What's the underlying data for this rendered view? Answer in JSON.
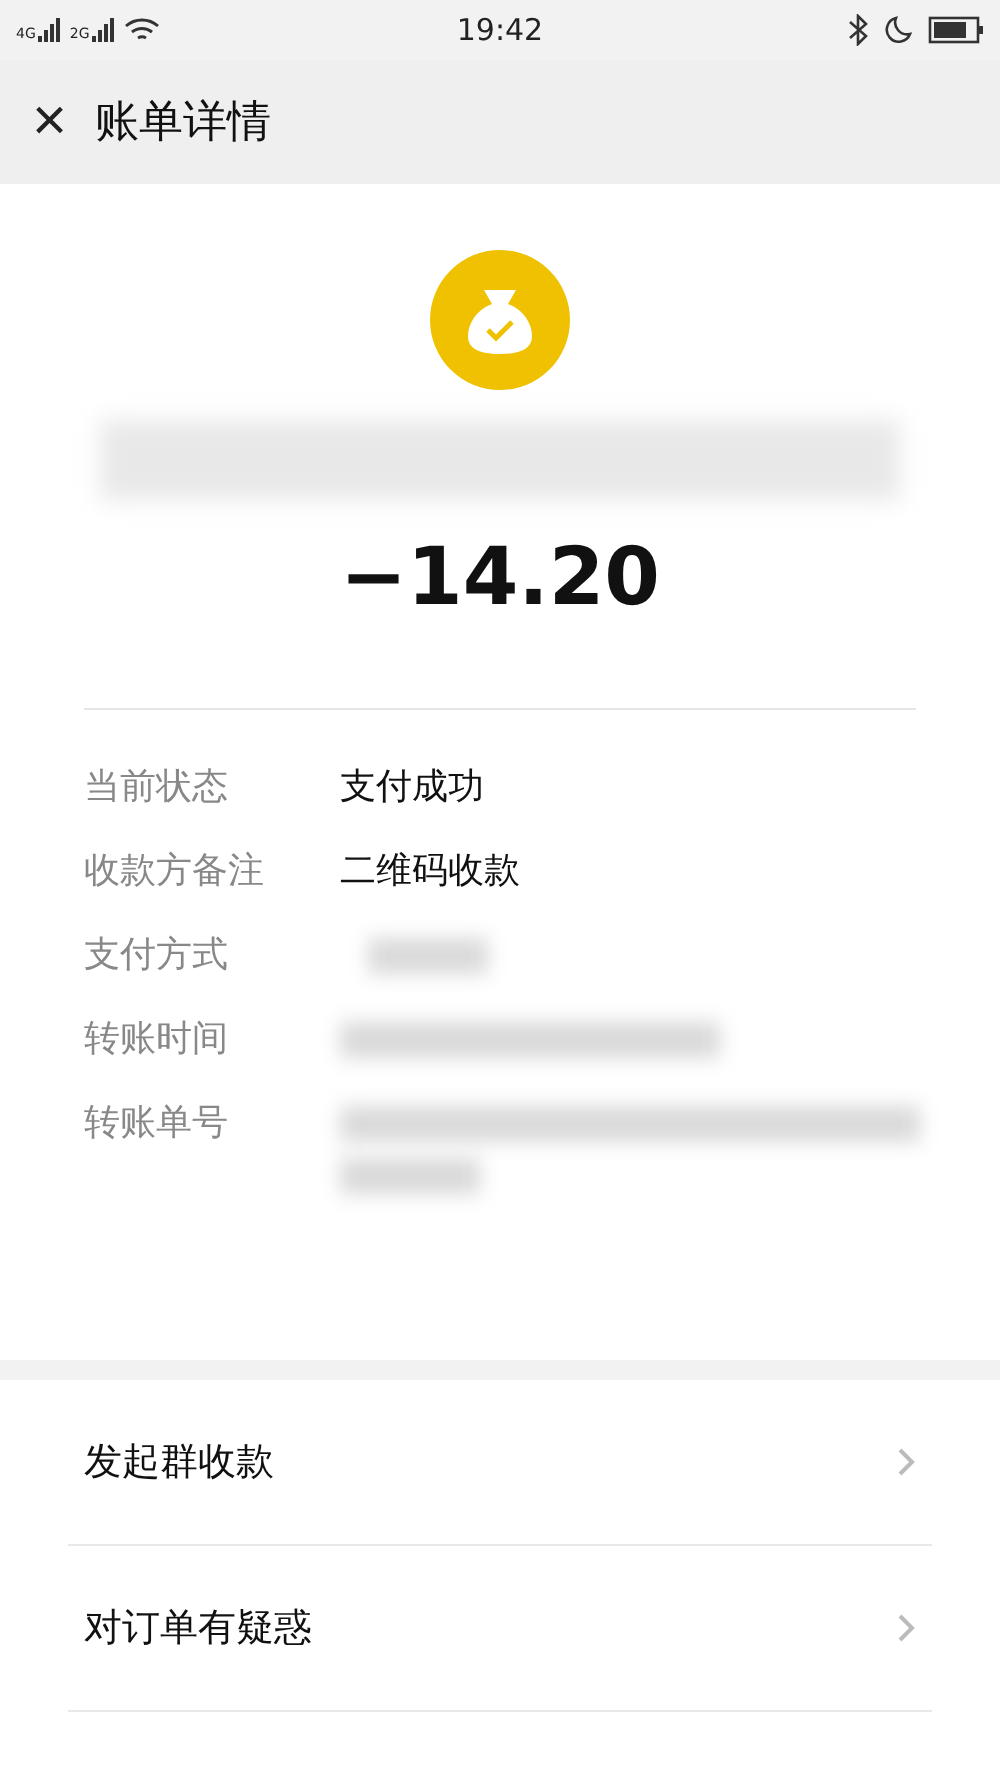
{
  "status_bar": {
    "network_1": "4G",
    "network_2": "2G",
    "time": "19:42"
  },
  "header": {
    "close": "×",
    "title": "账单详情"
  },
  "amount": "−14.20",
  "details": [
    {
      "kind": "text",
      "label": "当前状态",
      "value": "支付成功"
    },
    {
      "kind": "text",
      "label": "收款方备注",
      "value": "二维码收款"
    },
    {
      "kind": "blurred",
      "label": "支付方式"
    },
    {
      "kind": "blurred",
      "label": "转账时间"
    },
    {
      "kind": "blurred",
      "label": "转账单号"
    }
  ],
  "menu": [
    {
      "label": "发起群收款"
    },
    {
      "label": "对订单有疑惑"
    }
  ]
}
